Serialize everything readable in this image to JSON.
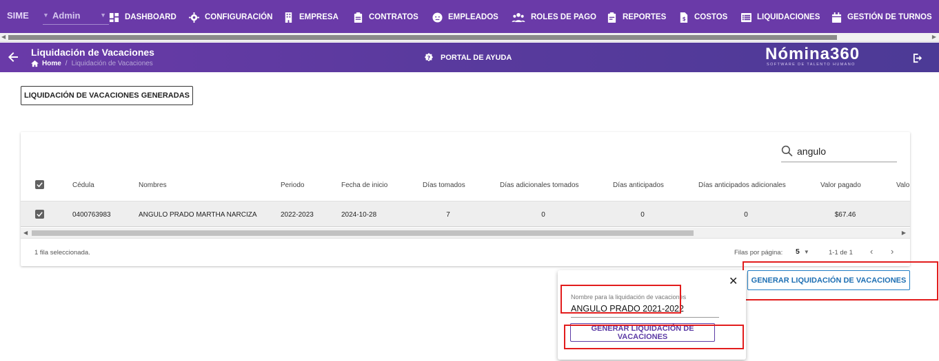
{
  "topnav": {
    "brand": "SIME",
    "user": "Admin",
    "items": [
      {
        "label": "DASHBOARD",
        "icon": "dashboard-icon"
      },
      {
        "label": "CONFIGURACIÓN",
        "icon": "gear-icon"
      },
      {
        "label": "EMPRESA",
        "icon": "building-icon"
      },
      {
        "label": "CONTRATOS",
        "icon": "clipboard-icon"
      },
      {
        "label": "EMPLEADOS",
        "icon": "face-icon"
      },
      {
        "label": "ROLES DE PAGO",
        "icon": "group-icon"
      },
      {
        "label": "REPORTES",
        "icon": "report-icon"
      },
      {
        "label": "COSTOS",
        "icon": "cost-file-icon"
      },
      {
        "label": "LIQUIDACIONES",
        "icon": "list-icon"
      },
      {
        "label": "GESTIÓN DE TURNOS",
        "icon": "calendar-icon"
      }
    ]
  },
  "header": {
    "title": "Liquidación de Vacaciones",
    "breadcrumb_home": "Home",
    "breadcrumb_current": "Liquidación de Vacaciones",
    "help_label": "PORTAL DE AYUDA",
    "logo_word": "Nómina360",
    "logo_tagline": "SOFTWARE DE TALENTO HUMANO"
  },
  "main": {
    "generated_button": "LIQUIDACIÓN DE VACACIONES GENERADAS",
    "search_value": "angulo",
    "columns": [
      "Cédula",
      "Nombres",
      "Periodo",
      "Fecha de inicio",
      "Días tomados",
      "Días adicionales tomados",
      "Días anticipados",
      "Días anticipados adicionales",
      "Valor pagado",
      "Valo"
    ],
    "row": {
      "cedula": "0400763983",
      "nombres": "ANGULO PRADO MARTHA NARCIZA",
      "periodo": "2022-2023",
      "fecha_inicio": "2024-10-28",
      "dias_tomados": "7",
      "dias_adicionales": "0",
      "dias_anticipados": "0",
      "dias_anticipados_adicionales": "0",
      "valor_pagado": "$67.46"
    },
    "selected_text": "1 fila seleccionada.",
    "rows_per_page_label": "Filas por página:",
    "rows_per_page": "5",
    "page_range": "1-1 de 1",
    "generate_button": "GENERAR LIQUIDACIÓN DE VACACIONES"
  },
  "popover": {
    "field_label": "Nombre para la liquidación de vacaciones",
    "field_value": "ANGULO PRADO 2021-2022",
    "button": "GENERAR LIQUIDACIÓN DE VACACIONES"
  },
  "colors": {
    "nav": "#6a3aa8",
    "accent_blue": "#1e6fb3",
    "highlight_red": "#e21b1b"
  }
}
